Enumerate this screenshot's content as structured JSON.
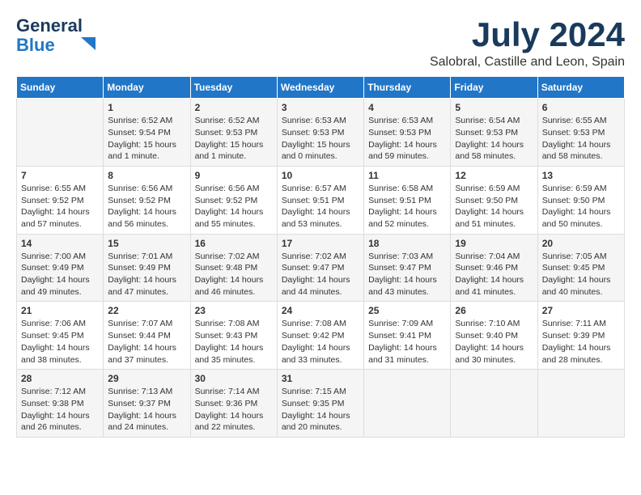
{
  "header": {
    "logo_line1": "General",
    "logo_line2": "Blue",
    "month": "July 2024",
    "location": "Salobral, Castille and Leon, Spain"
  },
  "days_of_week": [
    "Sunday",
    "Monday",
    "Tuesday",
    "Wednesday",
    "Thursday",
    "Friday",
    "Saturday"
  ],
  "weeks": [
    [
      {
        "day": "",
        "info": ""
      },
      {
        "day": "1",
        "info": "Sunrise: 6:52 AM\nSunset: 9:54 PM\nDaylight: 15 hours\nand 1 minute."
      },
      {
        "day": "2",
        "info": "Sunrise: 6:52 AM\nSunset: 9:53 PM\nDaylight: 15 hours\nand 1 minute."
      },
      {
        "day": "3",
        "info": "Sunrise: 6:53 AM\nSunset: 9:53 PM\nDaylight: 15 hours\nand 0 minutes."
      },
      {
        "day": "4",
        "info": "Sunrise: 6:53 AM\nSunset: 9:53 PM\nDaylight: 14 hours\nand 59 minutes."
      },
      {
        "day": "5",
        "info": "Sunrise: 6:54 AM\nSunset: 9:53 PM\nDaylight: 14 hours\nand 58 minutes."
      },
      {
        "day": "6",
        "info": "Sunrise: 6:55 AM\nSunset: 9:53 PM\nDaylight: 14 hours\nand 58 minutes."
      }
    ],
    [
      {
        "day": "7",
        "info": "Sunrise: 6:55 AM\nSunset: 9:52 PM\nDaylight: 14 hours\nand 57 minutes."
      },
      {
        "day": "8",
        "info": "Sunrise: 6:56 AM\nSunset: 9:52 PM\nDaylight: 14 hours\nand 56 minutes."
      },
      {
        "day": "9",
        "info": "Sunrise: 6:56 AM\nSunset: 9:52 PM\nDaylight: 14 hours\nand 55 minutes."
      },
      {
        "day": "10",
        "info": "Sunrise: 6:57 AM\nSunset: 9:51 PM\nDaylight: 14 hours\nand 53 minutes."
      },
      {
        "day": "11",
        "info": "Sunrise: 6:58 AM\nSunset: 9:51 PM\nDaylight: 14 hours\nand 52 minutes."
      },
      {
        "day": "12",
        "info": "Sunrise: 6:59 AM\nSunset: 9:50 PM\nDaylight: 14 hours\nand 51 minutes."
      },
      {
        "day": "13",
        "info": "Sunrise: 6:59 AM\nSunset: 9:50 PM\nDaylight: 14 hours\nand 50 minutes."
      }
    ],
    [
      {
        "day": "14",
        "info": "Sunrise: 7:00 AM\nSunset: 9:49 PM\nDaylight: 14 hours\nand 49 minutes."
      },
      {
        "day": "15",
        "info": "Sunrise: 7:01 AM\nSunset: 9:49 PM\nDaylight: 14 hours\nand 47 minutes."
      },
      {
        "day": "16",
        "info": "Sunrise: 7:02 AM\nSunset: 9:48 PM\nDaylight: 14 hours\nand 46 minutes."
      },
      {
        "day": "17",
        "info": "Sunrise: 7:02 AM\nSunset: 9:47 PM\nDaylight: 14 hours\nand 44 minutes."
      },
      {
        "day": "18",
        "info": "Sunrise: 7:03 AM\nSunset: 9:47 PM\nDaylight: 14 hours\nand 43 minutes."
      },
      {
        "day": "19",
        "info": "Sunrise: 7:04 AM\nSunset: 9:46 PM\nDaylight: 14 hours\nand 41 minutes."
      },
      {
        "day": "20",
        "info": "Sunrise: 7:05 AM\nSunset: 9:45 PM\nDaylight: 14 hours\nand 40 minutes."
      }
    ],
    [
      {
        "day": "21",
        "info": "Sunrise: 7:06 AM\nSunset: 9:45 PM\nDaylight: 14 hours\nand 38 minutes."
      },
      {
        "day": "22",
        "info": "Sunrise: 7:07 AM\nSunset: 9:44 PM\nDaylight: 14 hours\nand 37 minutes."
      },
      {
        "day": "23",
        "info": "Sunrise: 7:08 AM\nSunset: 9:43 PM\nDaylight: 14 hours\nand 35 minutes."
      },
      {
        "day": "24",
        "info": "Sunrise: 7:08 AM\nSunset: 9:42 PM\nDaylight: 14 hours\nand 33 minutes."
      },
      {
        "day": "25",
        "info": "Sunrise: 7:09 AM\nSunset: 9:41 PM\nDaylight: 14 hours\nand 31 minutes."
      },
      {
        "day": "26",
        "info": "Sunrise: 7:10 AM\nSunset: 9:40 PM\nDaylight: 14 hours\nand 30 minutes."
      },
      {
        "day": "27",
        "info": "Sunrise: 7:11 AM\nSunset: 9:39 PM\nDaylight: 14 hours\nand 28 minutes."
      }
    ],
    [
      {
        "day": "28",
        "info": "Sunrise: 7:12 AM\nSunset: 9:38 PM\nDaylight: 14 hours\nand 26 minutes."
      },
      {
        "day": "29",
        "info": "Sunrise: 7:13 AM\nSunset: 9:37 PM\nDaylight: 14 hours\nand 24 minutes."
      },
      {
        "day": "30",
        "info": "Sunrise: 7:14 AM\nSunset: 9:36 PM\nDaylight: 14 hours\nand 22 minutes."
      },
      {
        "day": "31",
        "info": "Sunrise: 7:15 AM\nSunset: 9:35 PM\nDaylight: 14 hours\nand 20 minutes."
      },
      {
        "day": "",
        "info": ""
      },
      {
        "day": "",
        "info": ""
      },
      {
        "day": "",
        "info": ""
      }
    ]
  ]
}
